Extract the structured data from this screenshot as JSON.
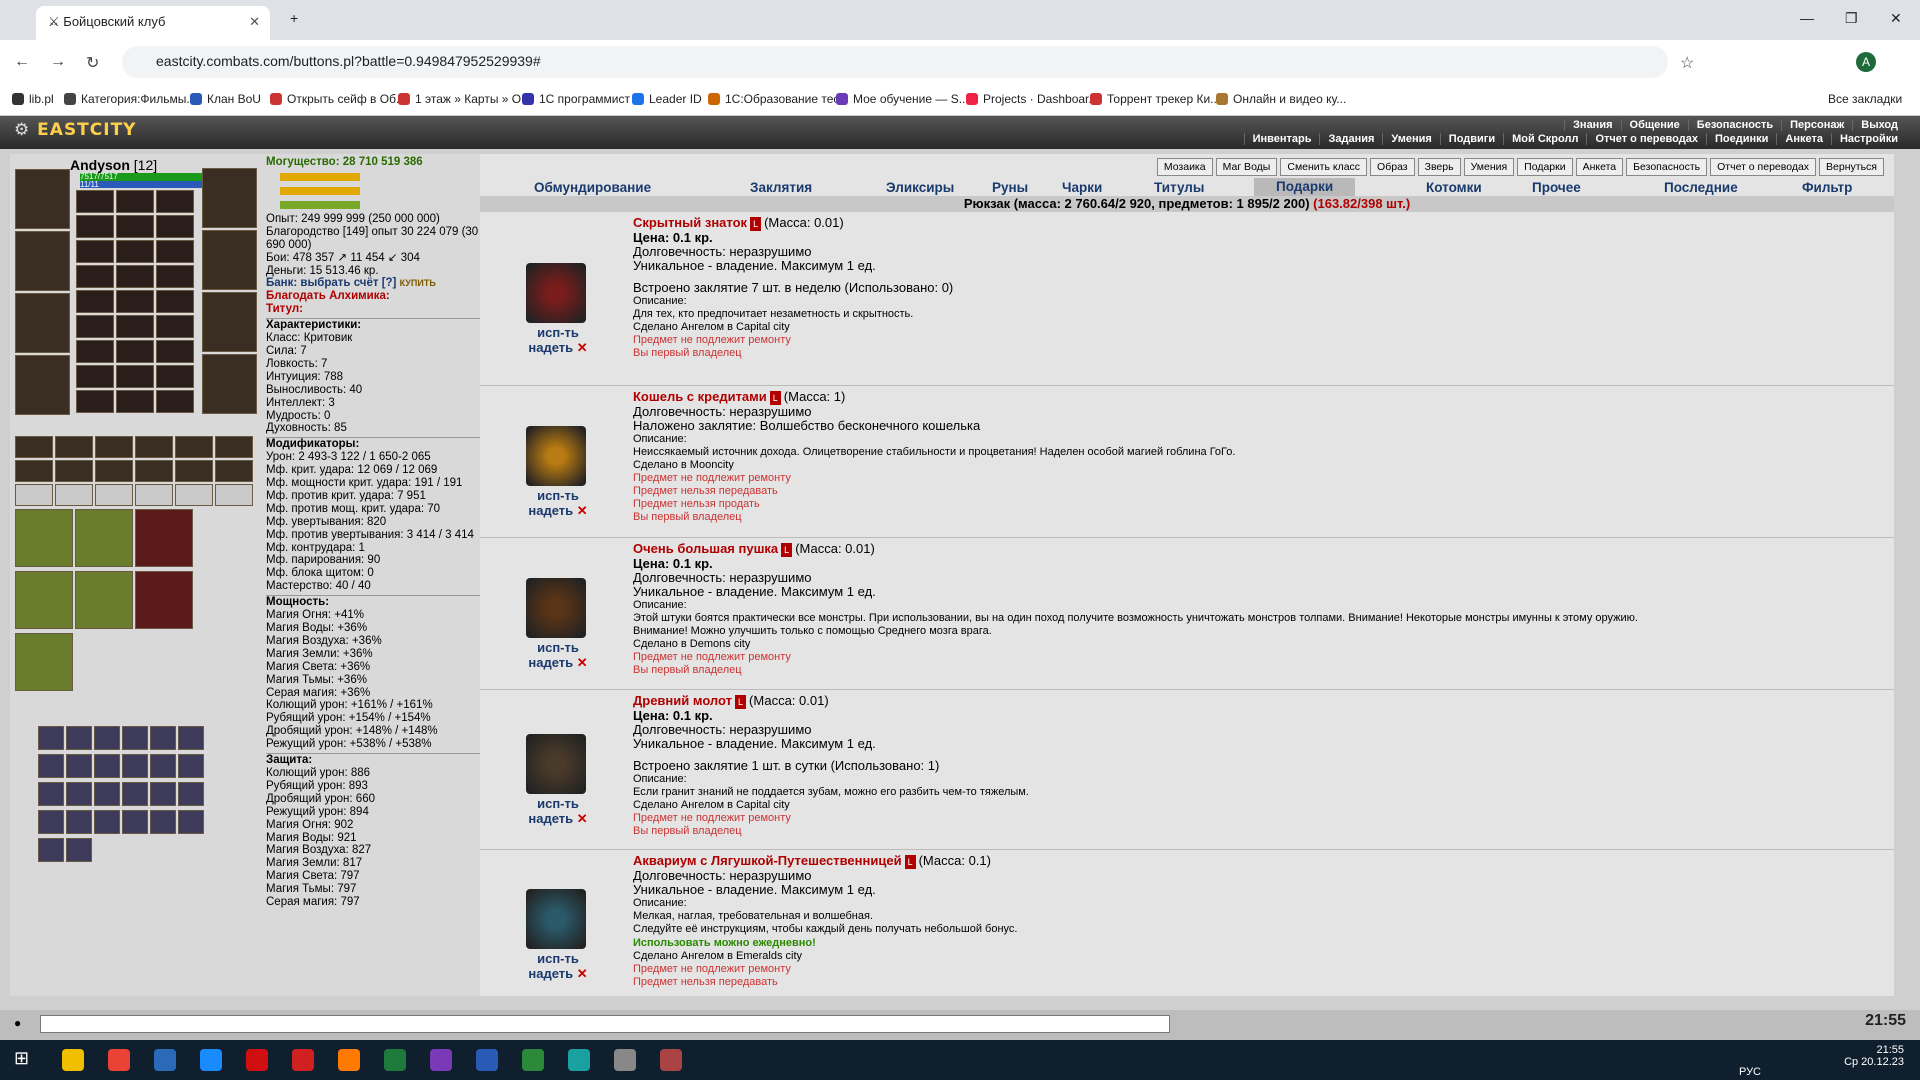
{
  "browser": {
    "tab_title": "Бойцовский клуб",
    "url": "eastcity.combats.com/buttons.pl?battle=0.949847952529939#",
    "bookmarks": [
      "lib.pl",
      "Категория:Фильмы...",
      "Клан BoU",
      "Открыть сейф в Об...",
      "1 этаж » Карты » О...",
      "1С программист",
      "Leader ID",
      "1С:Образование тест",
      "Мое обучение — S...",
      "Projects · Dashboar...",
      "Торрент трекер Ки...",
      "Онлайн и видео ку..."
    ],
    "all_bookmarks": "Все закладки"
  },
  "game": {
    "logo": "EASTCITY",
    "top_row1": [
      "Знания",
      "Общение",
      "Безопасность",
      "Персонаж",
      "Выход"
    ],
    "top_row2": [
      "Инвентарь",
      "Задания",
      "Умения",
      "Подвиги",
      "Мой Скролл",
      "Отчет о переводах",
      "Поединки",
      "Анкета",
      "Настройки"
    ]
  },
  "character": {
    "name": "Andyson",
    "level": "[12]",
    "hp": "7517/7517",
    "mana": "11/11"
  },
  "stats": {
    "power": "Могущество: 28 710 519 386",
    "exp": "Опыт: 249 999 999 (250 000 000)",
    "nobility": "Благородство [149] опыт 30 224 079 (30 690 000)",
    "fights": "Бои: 478 357 ↗ 11 454 ↙ 304",
    "money": "Деньги: 15 513.46 кр.",
    "bank": "Банк: выбрать счёт [?]",
    "buy": "КУПИТЬ",
    "blessing": "Благодать Алхимика:",
    "title": "Титул:",
    "chars_head": "Характеристики:",
    "chars": [
      "Класс: Критовик",
      "Сила: 7",
      "Ловкость: 7",
      "Интуиция: 788",
      "Выносливость: 40",
      "Интеллект: 3",
      "Мудрость: 0",
      "Духовность: 85"
    ],
    "mods_head": "Модификаторы:",
    "mods": [
      "Урон: 2 493-3 122 / 1 650-2 065",
      "Мф. крит. удара: 12 069 / 12 069",
      "Мф. мощности крит. удара: 191 / 191",
      "Мф. против крит. удара: 7 951",
      "Мф. против мощ. крит. удара: 70",
      "Мф. увертывания: 820",
      "Мф. против увертывания: 3 414 / 3 414",
      "Мф. контрудара: 1",
      "Мф. парирования: 90",
      "Мф. блока щитом: 0",
      "Мастерство: 40 / 40"
    ],
    "power_head": "Мощность:",
    "powers": [
      "Магия Огня: +41%",
      "Магия Воды: +36%",
      "Магия Воздуха: +36%",
      "Магия Земли: +36%",
      "Магия Света: +36%",
      "Магия Тьмы: +36%",
      "Серая магия: +36%",
      "Колющий урон: +161% / +161%",
      "Рубящий урон: +154% / +154%",
      "Дробящий урон: +148% / +148%",
      "Режущий урон: +538% / +538%"
    ],
    "def_head": "Защита:",
    "defs": [
      "Колющий урон: 886",
      "Рубящий урон: 893",
      "Дробящий урон: 660",
      "Режущий урон: 894",
      "Магия Огня: 902",
      "Магия Воды: 921",
      "Магия Воздуха: 827",
      "Магия Земли: 817",
      "Магия Света: 797",
      "Магия Тьмы: 797",
      "Серая магия: 797"
    ]
  },
  "actions": [
    "Мозаика",
    "Маг Воды",
    "Сменить класс",
    "Образ",
    "Зверь",
    "Умения",
    "Подарки",
    "Анкета",
    "Безопасность",
    "Отчет о переводах",
    "Вернуться"
  ],
  "inv_tabs": [
    "Обмундирование",
    "Заклятия",
    "Эликсиры",
    "Руны",
    "Чарки",
    "Титулы",
    "Подарки",
    "Котомки",
    "Прочее",
    "Последние",
    "Фильтр"
  ],
  "pack": "Рюкзак (масса: 2 760.64/2 920, предметов: 1 895/2 200)",
  "pack_extra": "(163.82/398 шт.)",
  "use": "исп-ть",
  "wear": "надеть",
  "items": [
    {
      "name": "Скрытный знаток",
      "mass": "(Масса: 0.01)",
      "lines": [
        "Цена: 0.1 кр.",
        "Долговечность: неразрушимо",
        "Уникальное - владение. Максимум 1 ед.",
        "Встроено заклятие 7 шт. в неделю (Использовано: 0)"
      ],
      "desc": "Описание:",
      "desc_lines": [
        "Для тех, кто предпочитает незаметность и скрытность.",
        "Сделано Ангелом в Capital city"
      ],
      "red": [
        "Предмет не подлежит ремонту",
        "Вы первый владелец"
      ],
      "icon": "#7a1c1c"
    },
    {
      "name": "Кошель с кредитами",
      "mass": "(Масса: 1)",
      "lines": [
        "Долговечность: неразрушимо",
        "Наложено заклятие: Волшебство бесконечного кошелька"
      ],
      "desc": "Описание:",
      "desc_lines": [
        "Неиссякаемый источник дохода. Олицетворение стабильности и процветания! Наделен особой магией гоблина ГоГо.",
        "Сделано в Mooncity"
      ],
      "red": [
        "Предмет не подлежит ремонту",
        "Предмет нельзя передавать",
        "Предмет нельзя продать",
        "Вы первый владелец"
      ],
      "icon": "#b87a12"
    },
    {
      "name": "Очень большая пушка",
      "mass": "(Масса: 0.01)",
      "lines": [
        "Цена: 0.1 кр.",
        "Долговечность: неразрушимо",
        "Уникальное - владение. Максимум 1 ед."
      ],
      "desc": "Описание:",
      "desc_lines": [
        "Этой штуки боятся практически все монстры. При использовании, вы на один поход получите возможность уничтожать монстров толпами. Внимание! Некоторые монстры имунны к этому оружию.",
        "Внимание! Можно улучшить только с помощью Среднего мозга врага.",
        "Сделано в Demons city"
      ],
      "red": [
        "Предмет не подлежит ремонту",
        "Вы первый владелец"
      ],
      "icon": "#5a3416"
    },
    {
      "name": "Древний молот",
      "mass": "(Масса: 0.01)",
      "lines": [
        "Цена: 0.1 кр.",
        "Долговечность: неразрушимо",
        "Уникальное - владение. Максимум 1 ед.",
        "Встроено заклятие 1 шт. в сутки (Использовано: 1)"
      ],
      "desc": "Описание:",
      "desc_lines": [
        "Если гранит знаний не поддается зубам, можно его разбить чем-то тяжелым.",
        "Сделано Ангелом в Capital city"
      ],
      "red": [
        "Предмет не подлежит ремонту",
        "Вы первый владелец"
      ],
      "icon": "#4a3a2a"
    },
    {
      "name": "Аквариум с Лягушкой-Путешественницей",
      "mass": "(Масса: 0.1)",
      "lines": [
        "Долговечность: неразрушимо",
        "Уникальное - владение. Максимум 1 ед."
      ],
      "desc": "Описание:",
      "desc_lines": [
        "Мелкая, наглая, требовательная и волшебная.",
        "Следуйте её инструкциям, чтобы каждый день получать небольшой бонус."
      ],
      "green": "Использовать можно ежедневно!",
      "desc_after": "Сделано Ангелом в Emeralds city",
      "red": [
        "Предмет не подлежит ремонту",
        "Предмет нельзя передавать"
      ],
      "icon": "#2a5a6a"
    }
  ],
  "clock": "21:55",
  "tray": {
    "lang": "РУС",
    "time": "21:55",
    "date": "Ср 20.12.23"
  }
}
